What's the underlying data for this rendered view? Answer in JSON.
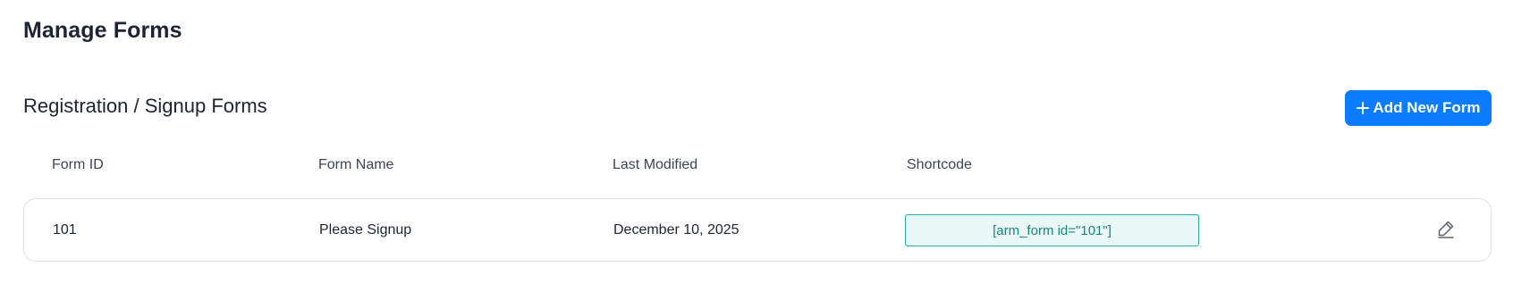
{
  "page": {
    "title": "Manage Forms"
  },
  "section": {
    "title": "Registration / Signup Forms",
    "add_button_label": "Add New Form"
  },
  "table": {
    "columns": [
      "Form ID",
      "Form Name",
      "Last Modified",
      "Shortcode"
    ],
    "rows": [
      {
        "form_id": "101",
        "form_name": "Please Signup",
        "last_modified": "December 10, 2025",
        "shortcode": "[arm_form id=\"101\"]"
      }
    ]
  },
  "icons": {
    "add": "plus-icon",
    "edit": "pencil-icon"
  },
  "colors": {
    "primary": "#0a7cff",
    "shortcode_border": "#25b2a6",
    "shortcode_bg": "#eaf9f7",
    "shortcode_text": "#16867c"
  }
}
